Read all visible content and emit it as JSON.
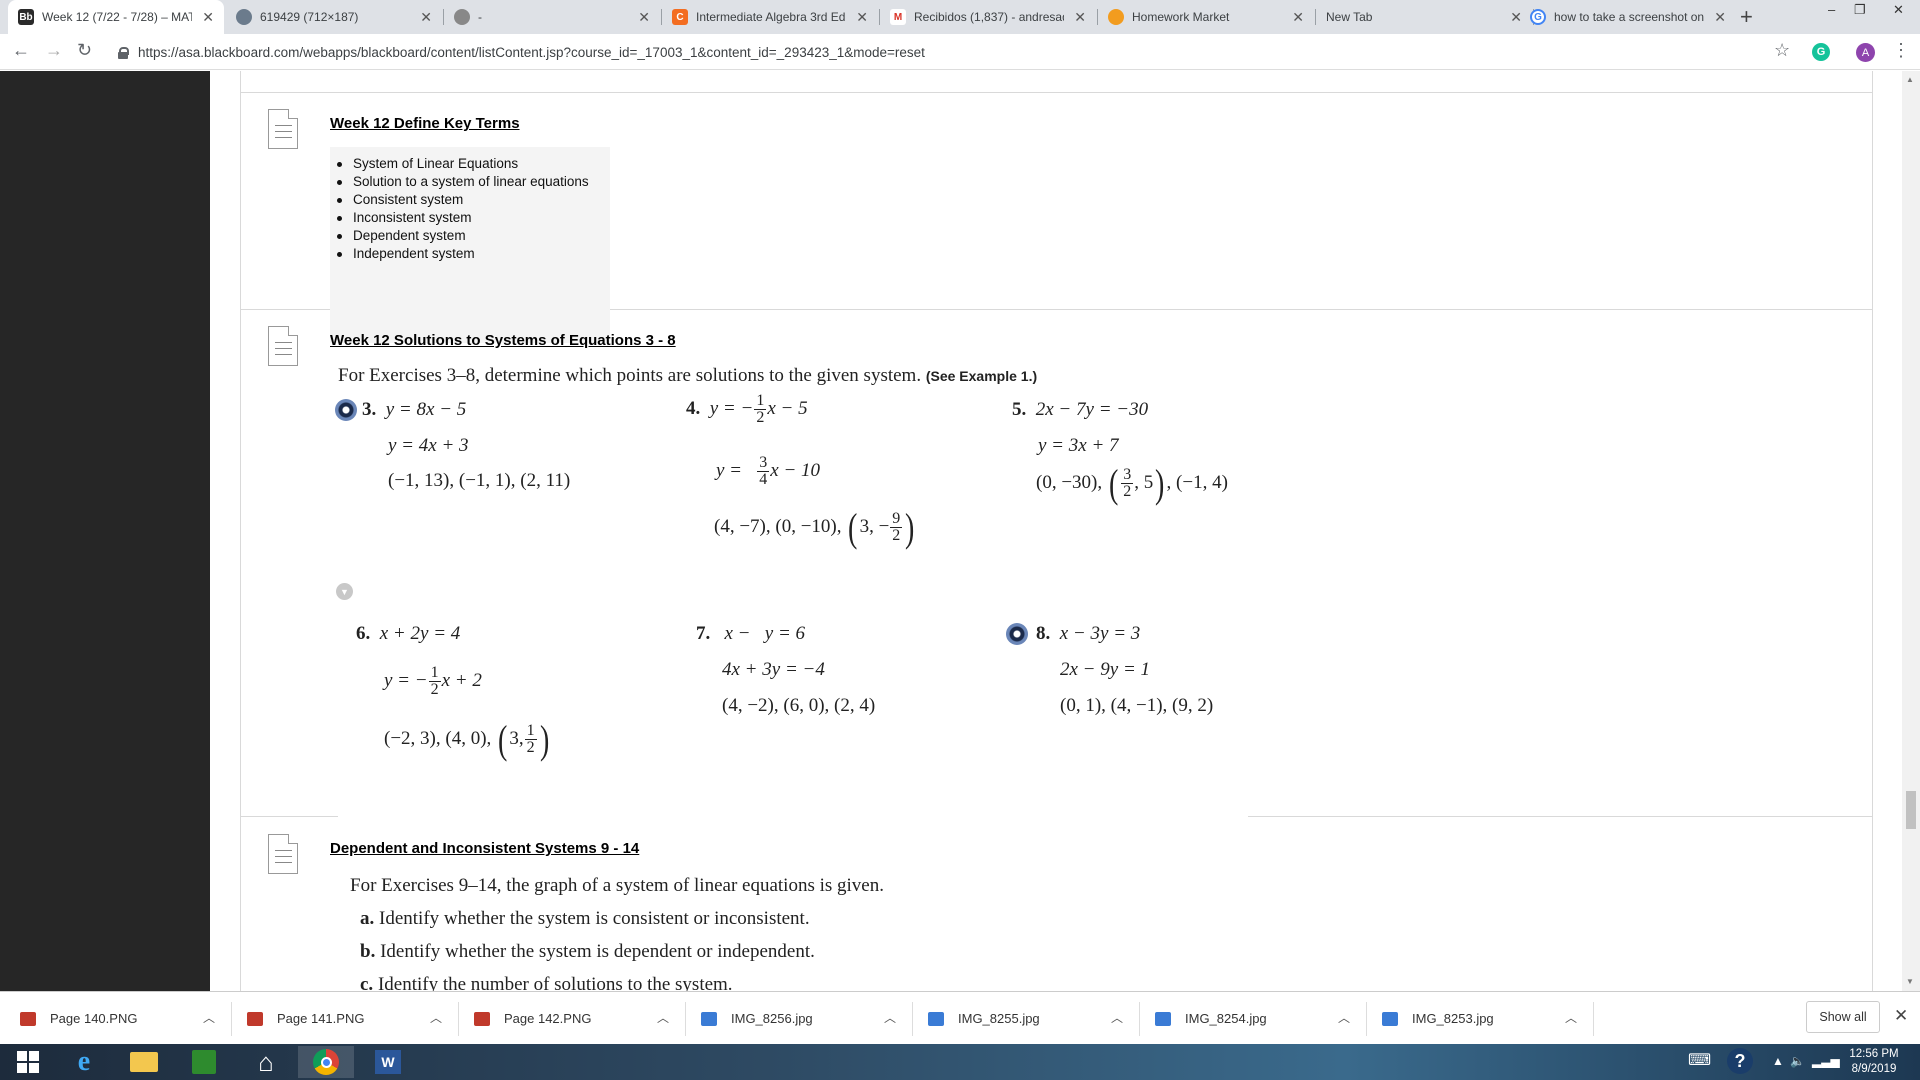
{
  "tabs": [
    {
      "title": "Week 12 (7/22 - 7/28) – MAT",
      "favicon": "Bb",
      "color": "#2a2a2a",
      "active": true
    },
    {
      "title": "619429 (712×187)",
      "favicon": "",
      "color": "#6b7b8c"
    },
    {
      "title": "-",
      "favicon": "",
      "color": "#888888"
    },
    {
      "title": "Intermediate Algebra 3rd Ed",
      "favicon": "C",
      "color": "#f36d21"
    },
    {
      "title": "Recibidos (1,837) - andresad",
      "favicon": "M",
      "color": "#d93025"
    },
    {
      "title": "Homework Market",
      "favicon": "",
      "color": "#f29c1f"
    },
    {
      "title": "New Tab",
      "favicon": "",
      "color": "#dee1e6"
    },
    {
      "title": "how to take a screenshot on",
      "favicon": "G",
      "color": "#4285f4"
    }
  ],
  "address": {
    "url": "https://asa.blackboard.com/webapps/blackboard/content/listContent.jsp?course_id=_17003_1&content_id=_293423_1&mode=reset"
  },
  "profile_initial": "A",
  "grammarly_initial": "G",
  "items": {
    "key_terms": {
      "title": "Week 12 Define Key Terms",
      "terms": [
        "System of Linear Equations",
        "Solution to a system of linear equations",
        "Consistent system",
        "Inconsistent system",
        "Dependent system",
        "Independent system"
      ]
    },
    "solutions": {
      "title": "Week 12 Solutions to Systems of Equations 3 - 8",
      "intro": "For Exercises 3–8, determine which points are solutions to the given system.",
      "see": "(See Example 1.)",
      "ex3": {
        "num": "3.",
        "eq1": "y = 8x − 5",
        "eq2": "y = 4x + 3",
        "pts": "(−1, 13), (−1, 1), (2, 11)"
      },
      "ex4": {
        "num": "4.",
        "eq1a": "y = −",
        "eq1n": "1",
        "eq1d": "2",
        "eq1b": "x − 5",
        "eq2a": "y = ",
        "eq2n": "3",
        "eq2d": "4",
        "eq2b": "x − 10",
        "pts": "(4, −7), (0, −10),",
        "p3a": "3, −",
        "p3n": "9",
        "p3d": "2"
      },
      "ex5": {
        "num": "5.",
        "eq1": "2x − 7y = −30",
        "eq2": "y = 3x + 7",
        "pts": "(0, −30),",
        "p2n": "3",
        "p2d": "2",
        "p2b": ", 5",
        "pts2": ", (−1, 4)"
      },
      "ex6": {
        "num": "6.",
        "eq1": "x + 2y = 4",
        "eq2a": "y = −",
        "eq2n": "1",
        "eq2d": "2",
        "eq2b": "x + 2",
        "pts": "(−2, 3), (4, 0),",
        "p3a": "3,",
        "p3n": "1",
        "p3d": "2"
      },
      "ex7": {
        "num": "7.",
        "eq1": "x −   y = 6",
        "eq2": "4x + 3y = −4",
        "pts": "(4, −2), (6, 0), (2, 4)"
      },
      "ex8": {
        "num": "8.",
        "eq1": "x − 3y = 3",
        "eq2": "2x − 9y = 1",
        "pts": "(0, 1), (4, −1), (9, 2)"
      }
    },
    "dependent": {
      "title": "Dependent and Inconsistent Systems 9 - 14",
      "intro": "For Exercises 9–14, the graph of a system of linear equations is given.",
      "a_label": "a.",
      "a_text": "Identify whether the system is consistent or inconsistent.",
      "b_label": "b.",
      "b_text": "Identify whether the system is dependent or independent.",
      "c_label": "c.",
      "c_text": "Identify the number of solutions to the system."
    }
  },
  "downloads": [
    {
      "name": "Page 140.PNG",
      "color": "#c0392b"
    },
    {
      "name": "Page 141.PNG",
      "color": "#c0392b"
    },
    {
      "name": "Page 142.PNG",
      "color": "#c0392b"
    },
    {
      "name": "IMG_8256.jpg",
      "color": "#3a7bd5"
    },
    {
      "name": "IMG_8255.jpg",
      "color": "#3a7bd5"
    },
    {
      "name": "IMG_8254.jpg",
      "color": "#3a7bd5"
    },
    {
      "name": "IMG_8253.jpg",
      "color": "#3a7bd5"
    }
  ],
  "show_all": "Show all",
  "clock": {
    "time": "12:56 PM",
    "date": "8/9/2019"
  }
}
